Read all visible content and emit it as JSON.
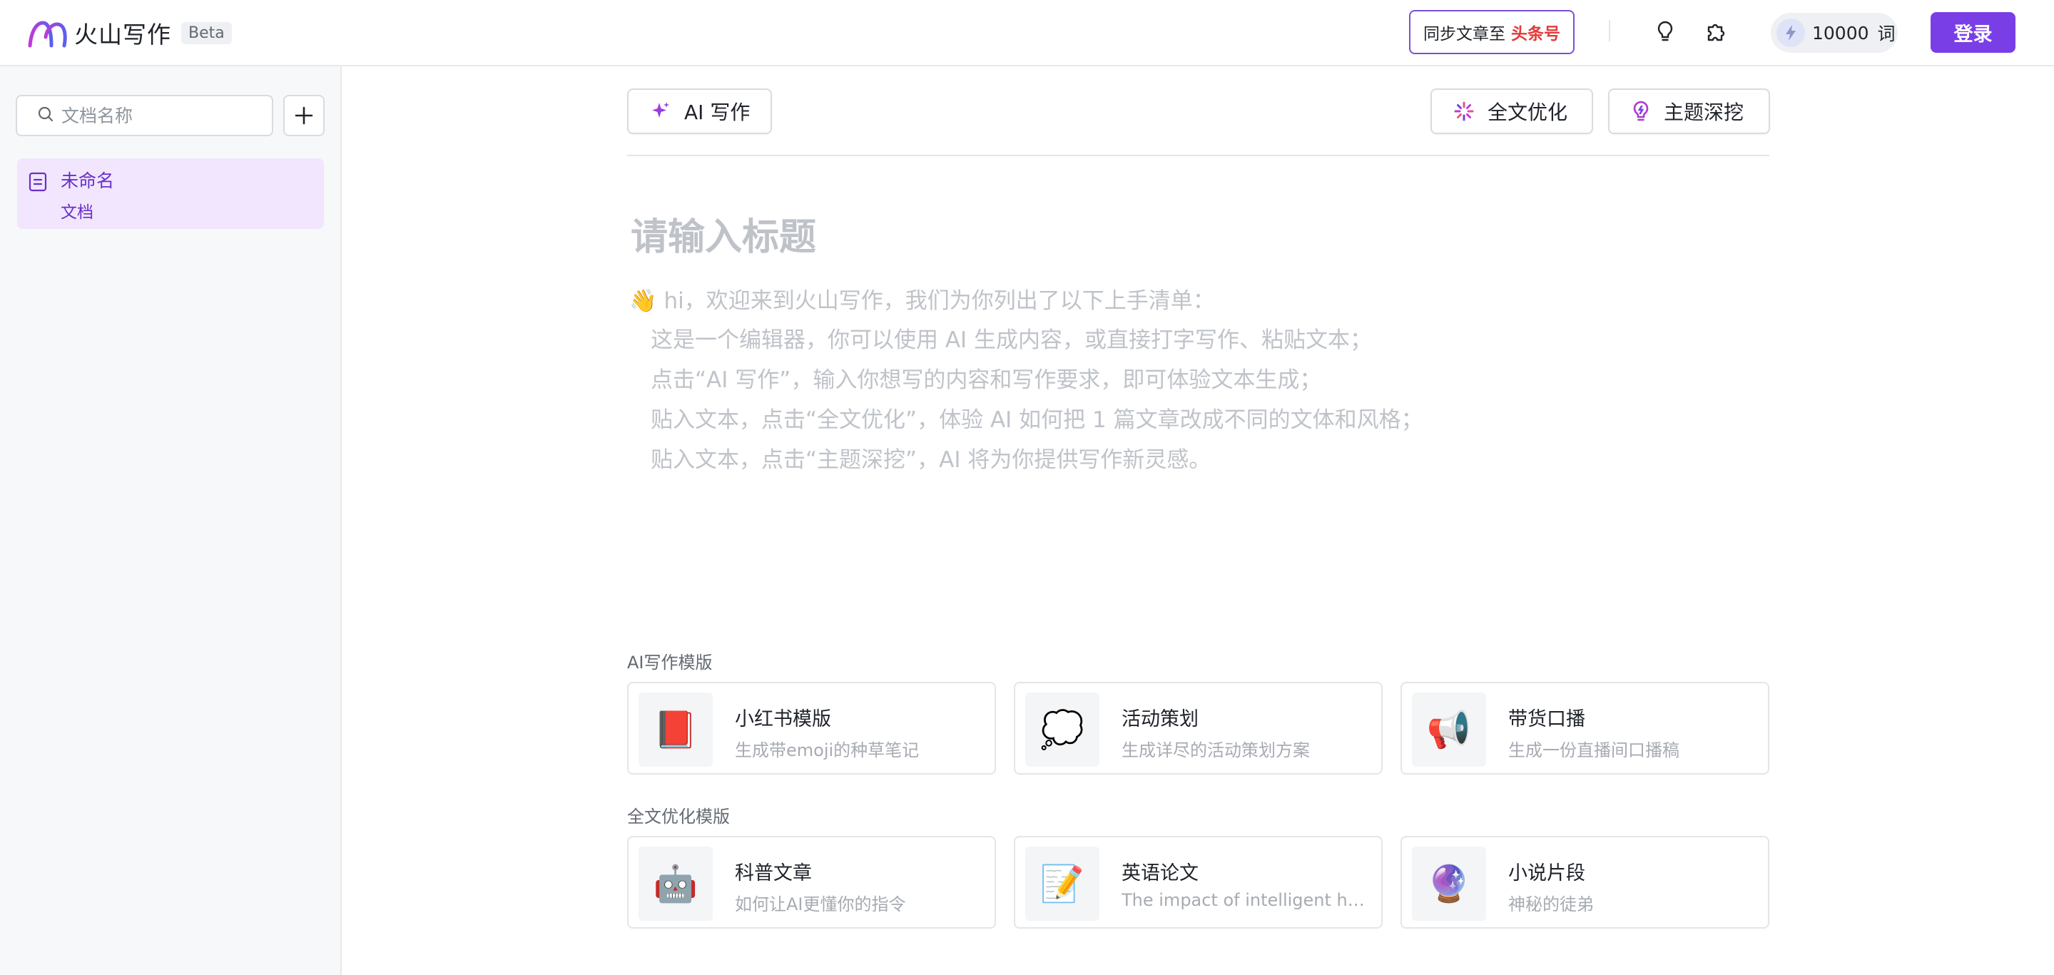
{
  "header": {
    "logo_text": "火山写作",
    "beta_label": "Beta",
    "sync_prefix": "同步文章至",
    "sync_brand": "头条号",
    "credits_value": "10000",
    "credits_unit": "词",
    "login_label": "登录",
    "icons": [
      "lightbulb-icon",
      "puzzle-icon",
      "bolt-icon"
    ]
  },
  "sidebar": {
    "search_placeholder": "文档名称",
    "documents": [
      {
        "title": "未命名",
        "subtitle": "文档",
        "selected": true
      }
    ]
  },
  "editor": {
    "ai_write_label": "AI 写作",
    "optimize_label": "全文优化",
    "topic_label": "主题深挖",
    "title_placeholder": "请输入标题",
    "guide": [
      "👋 hi，欢迎来到火山写作，我们为你列出了以下上手清单：",
      "这是一个编辑器，你可以使用 AI 生成内容，或直接打字写作、粘贴文本；",
      "点击“AI 写作”，输入你想写的内容和写作要求，即可体验文本生成；",
      "贴入文本，点击“全文优化”，体验 AI 如何把 1 篇文章改成不同的文体和风格；",
      "贴入文本，点击“主题深挖”，AI 将为你提供写作新灵感。"
    ]
  },
  "templates": {
    "ai_section_title": "AI写作模版",
    "ai_cards": [
      {
        "icon": "📕",
        "title": "小红书模版",
        "desc": "生成带emoji的种草笔记"
      },
      {
        "icon": "💭",
        "title": "活动策划",
        "desc": "生成详尽的活动策划方案"
      },
      {
        "icon": "📢",
        "title": "带货口播",
        "desc": "生成一份直播间口播稿"
      }
    ],
    "opt_section_title": "全文优化模版",
    "opt_cards": [
      {
        "icon": "🤖",
        "title": "科普文章",
        "desc": "如何让AI更懂你的指令"
      },
      {
        "icon": "📝",
        "title": "英语论文",
        "desc": "The impact of intelligent household appliances"
      },
      {
        "icon": "🔮",
        "title": "小说片段",
        "desc": "神秘的徒弟"
      }
    ]
  },
  "colors": {
    "accent": "#7a3ee6",
    "selected_bg": "#f1e6fd",
    "brand_red": "#e33a3a"
  }
}
